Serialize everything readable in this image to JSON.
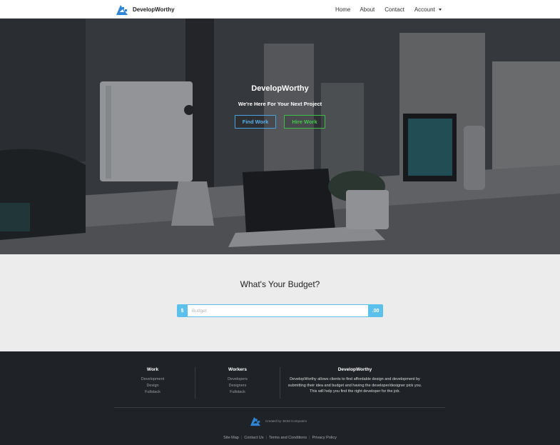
{
  "nav": {
    "brand": "DevelopWorthy",
    "links": [
      {
        "label": "Home"
      },
      {
        "label": "About"
      },
      {
        "label": "Contact"
      },
      {
        "label": "Account"
      }
    ]
  },
  "hero": {
    "title": "DevelopWorthy",
    "subtitle": "We're Here For Your Next Project",
    "find_work": "Find Work",
    "hire_work": "Hire Work"
  },
  "budget": {
    "title": "What's Your Budget?",
    "prefix": "$",
    "suffix": ".00",
    "placeholder": "Budget"
  },
  "footer": {
    "work": {
      "heading": "Work",
      "items": [
        "Development",
        "Design",
        "Fullstack"
      ]
    },
    "workers": {
      "heading": "Workers",
      "items": [
        "Developers",
        "Designers",
        "Fullstack"
      ]
    },
    "about": {
      "heading": "DevelopWorthy",
      "lines": [
        "DevelopWorthy allows clients to find affordable design and development by",
        "submitting their idea and budget and having the developer/designer pick you.",
        "This will help you find the right developer for the job."
      ]
    },
    "credit": "Created by: BOM Computers",
    "links": [
      "Site Map",
      "Contact Us",
      "Terms and Conditions",
      "Privacy Policy"
    ]
  },
  "colors": {
    "accent_blue": "#5bc0eb",
    "find_work_border": "#4aa3e0",
    "hire_work_border": "#3fbf4a",
    "footer_bg": "#1f2226",
    "budget_bg": "#ececec"
  },
  "icons": {
    "brand_logo": "developworthy-logo-icon",
    "account_caret": "caret-down-icon"
  }
}
